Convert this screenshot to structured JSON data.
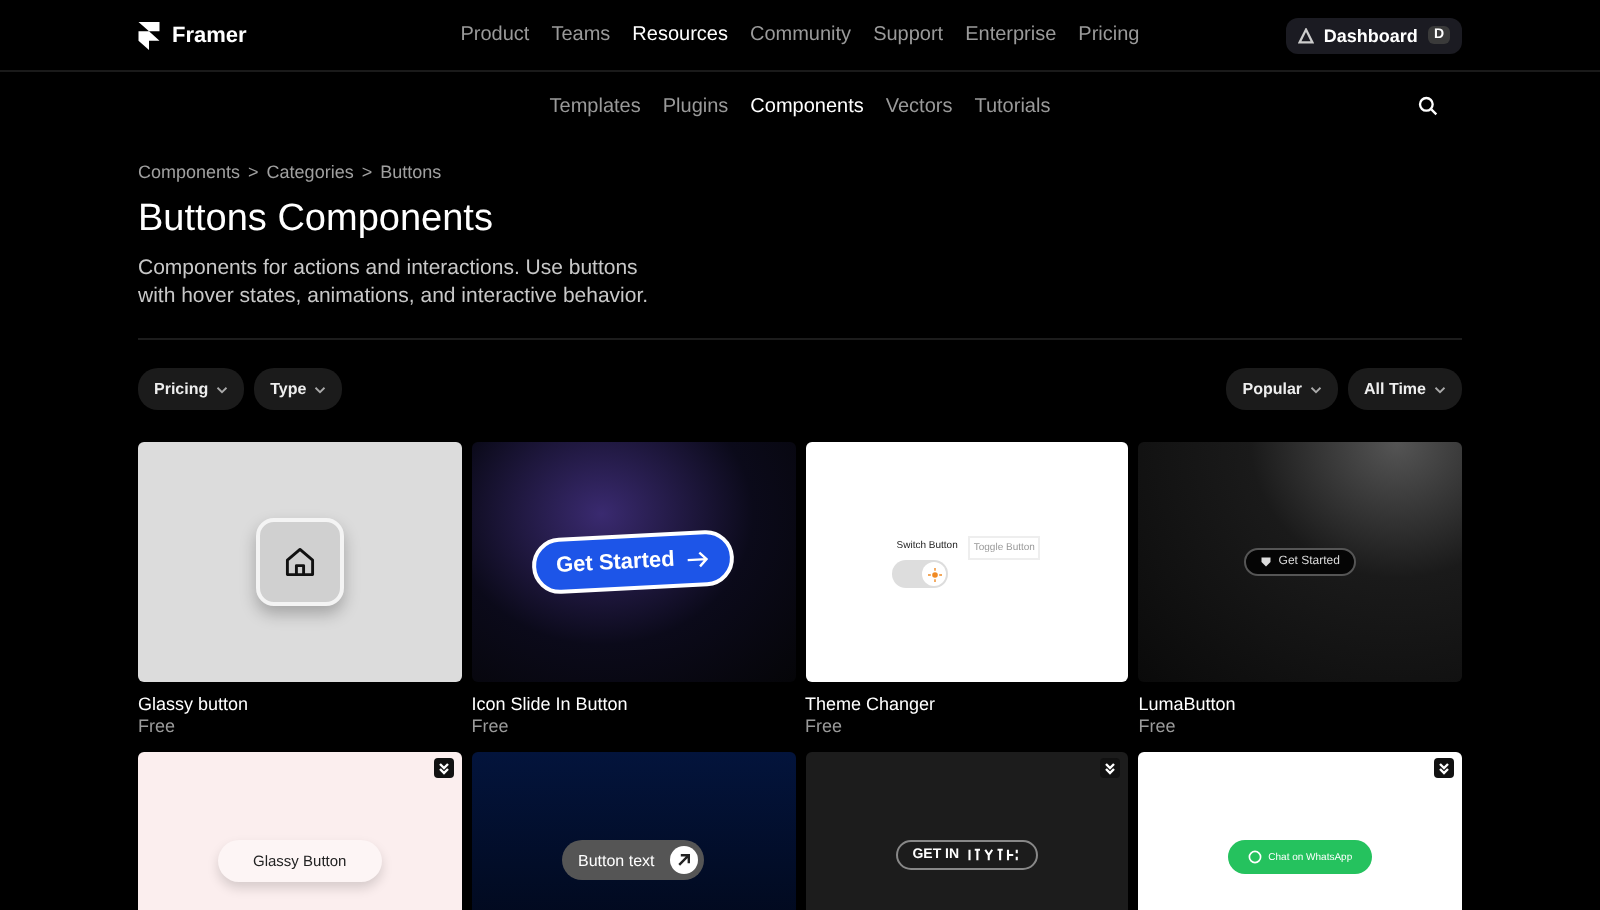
{
  "brand": {
    "name": "Framer"
  },
  "main_nav": [
    {
      "label": "Product",
      "selected": false
    },
    {
      "label": "Teams",
      "selected": false
    },
    {
      "label": "Resources",
      "selected": true
    },
    {
      "label": "Community",
      "selected": false
    },
    {
      "label": "Support",
      "selected": false
    },
    {
      "label": "Enterprise",
      "selected": false
    },
    {
      "label": "Pricing",
      "selected": false
    }
  ],
  "dashboard_button": {
    "label": "Dashboard",
    "key": "D"
  },
  "sub_nav": [
    {
      "label": "Templates",
      "selected": false
    },
    {
      "label": "Plugins",
      "selected": false
    },
    {
      "label": "Components",
      "selected": true
    },
    {
      "label": "Vectors",
      "selected": false
    },
    {
      "label": "Tutorials",
      "selected": false
    }
  ],
  "breadcrumb": [
    "Components",
    "Categories",
    "Buttons"
  ],
  "breadcrumb_separator": ">",
  "heading": "Buttons Components",
  "description": "Components for actions and interactions. Use buttons with hover states, animations, and interactive behavior.",
  "filters_left": [
    "Pricing",
    "Type"
  ],
  "filters_right": [
    "Popular",
    "All Time"
  ],
  "cards": [
    {
      "kind": "glassy-icon",
      "title": "Glassy button",
      "price": "Free",
      "badge": false
    },
    {
      "kind": "slide-in",
      "title": "Icon Slide In Button",
      "price": "Free",
      "badge": false,
      "preview_label": "Get Started"
    },
    {
      "kind": "theme-switch",
      "title": "Theme Changer",
      "price": "Free",
      "badge": false,
      "preview_label": "Switch Button",
      "preview_label_2": "Toggle Button",
      "on": true
    },
    {
      "kind": "luma",
      "title": "LumaButton",
      "price": "Free",
      "badge": false,
      "preview_label": "Get Started"
    },
    {
      "kind": "glassy-pill",
      "badge": true,
      "preview_label": "Glassy Button"
    },
    {
      "kind": "button-text",
      "badge": false,
      "preview_label": "Button text"
    },
    {
      "kind": "get-in",
      "badge": true,
      "preview_label": "GET IN"
    },
    {
      "kind": "whatsapp",
      "badge": true,
      "preview_label": "Chat on WhatsApp"
    }
  ]
}
